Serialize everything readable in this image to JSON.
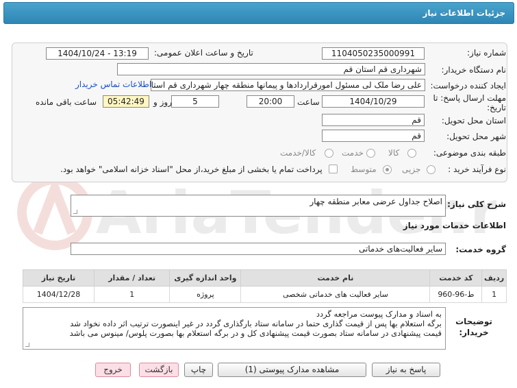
{
  "header": {
    "title": "جزئیات اطلاعات نیاز"
  },
  "form": {
    "need_number_label": "شماره نیاز:",
    "need_number": "1104050235000991",
    "announce_label": "تاریخ و ساعت اعلان عمومی:",
    "announce_value": "1404/10/24 - 13:19",
    "buyer_org_label": "نام دستگاه خریدار:",
    "buyer_org": "شهرداری قم استان قم",
    "creator_label": "ایجاد کننده درخواست:",
    "creator": "علی رضا ملک لی مسئول امورقراردادها و پیمانها منطقه چهار  شهرداری قم استان قم",
    "contact_link": "اطلاعات تماس خریدار",
    "deadline_label": "مهلت ارسال پاسخ: تا تاریخ:",
    "deadline_date": "1404/10/29",
    "time_label": "ساعت",
    "deadline_time": "20:00",
    "days": "5",
    "days_label": "روز و",
    "remaining": "05:42:49",
    "remaining_label": "ساعت باقی مانده",
    "province_label": "استان محل تحویل:",
    "province": "قم",
    "city_label": "شهر محل تحویل:",
    "city": "قم",
    "category_label": "طبقه بندی موضوعی:",
    "category_options": [
      "کالا",
      "خدمت",
      "کالا/خدمت"
    ],
    "process_label": "نوع فرآیند خرید :",
    "process_options": [
      "جزیی",
      "متوسط"
    ],
    "payment_note": "پرداخت تمام یا بخشی از مبلغ خرید،از محل \"اسناد خزانه اسلامی\" خواهد بود."
  },
  "need_desc": {
    "label": "شرح کلی نیاز:",
    "value": "اصلاح جداول عرضی معابر منطقه چهار"
  },
  "services": {
    "section_title": "اطلاعات خدمات مورد نیاز",
    "group_label": "گروه خدمت:",
    "group_value": "سایر فعالیت‌های خدماتی",
    "columns": [
      "ردیف",
      "کد خدمت",
      "نام خدمت",
      "واحد اندازه گیری",
      "تعداد / مقدار",
      "تاریخ نیاز"
    ],
    "rows": [
      {
        "index": "1",
        "code": "ط-96-960",
        "name": "سایر فعالیت های خدماتی شخصی",
        "unit": "پروژه",
        "qty": "1",
        "date": "1404/12/28"
      }
    ]
  },
  "buyer_notes": {
    "label": "توضیحات خریدار:",
    "lines": [
      "به اسناد و مدارک پیوست مراجعه گردد",
      "برگه استعلام بها پس از قیمت گذاری حتما در سامانه ستاد بارگذاری گردد در غیر اینصورت ترتیب اثر داده نخواد شد",
      "قیمت پیشنهادی در سامانه ستاد بصورت قیمت پیشنهادی کل و در برگه استعلام بها بصورت پلوس/ مینوس می باشد"
    ]
  },
  "buttons": {
    "reply": "پاسخ به نیاز",
    "attachments": "مشاهده مدارک پیوستی (1)",
    "print": "چاپ",
    "back": "بازگشت",
    "exit": "خروج"
  },
  "watermark": {
    "text": "AriaTender.net"
  },
  "colors": {
    "header": "#2e86b4",
    "link": "#1a4fc2",
    "remaining_bg": "#fff7c2"
  }
}
